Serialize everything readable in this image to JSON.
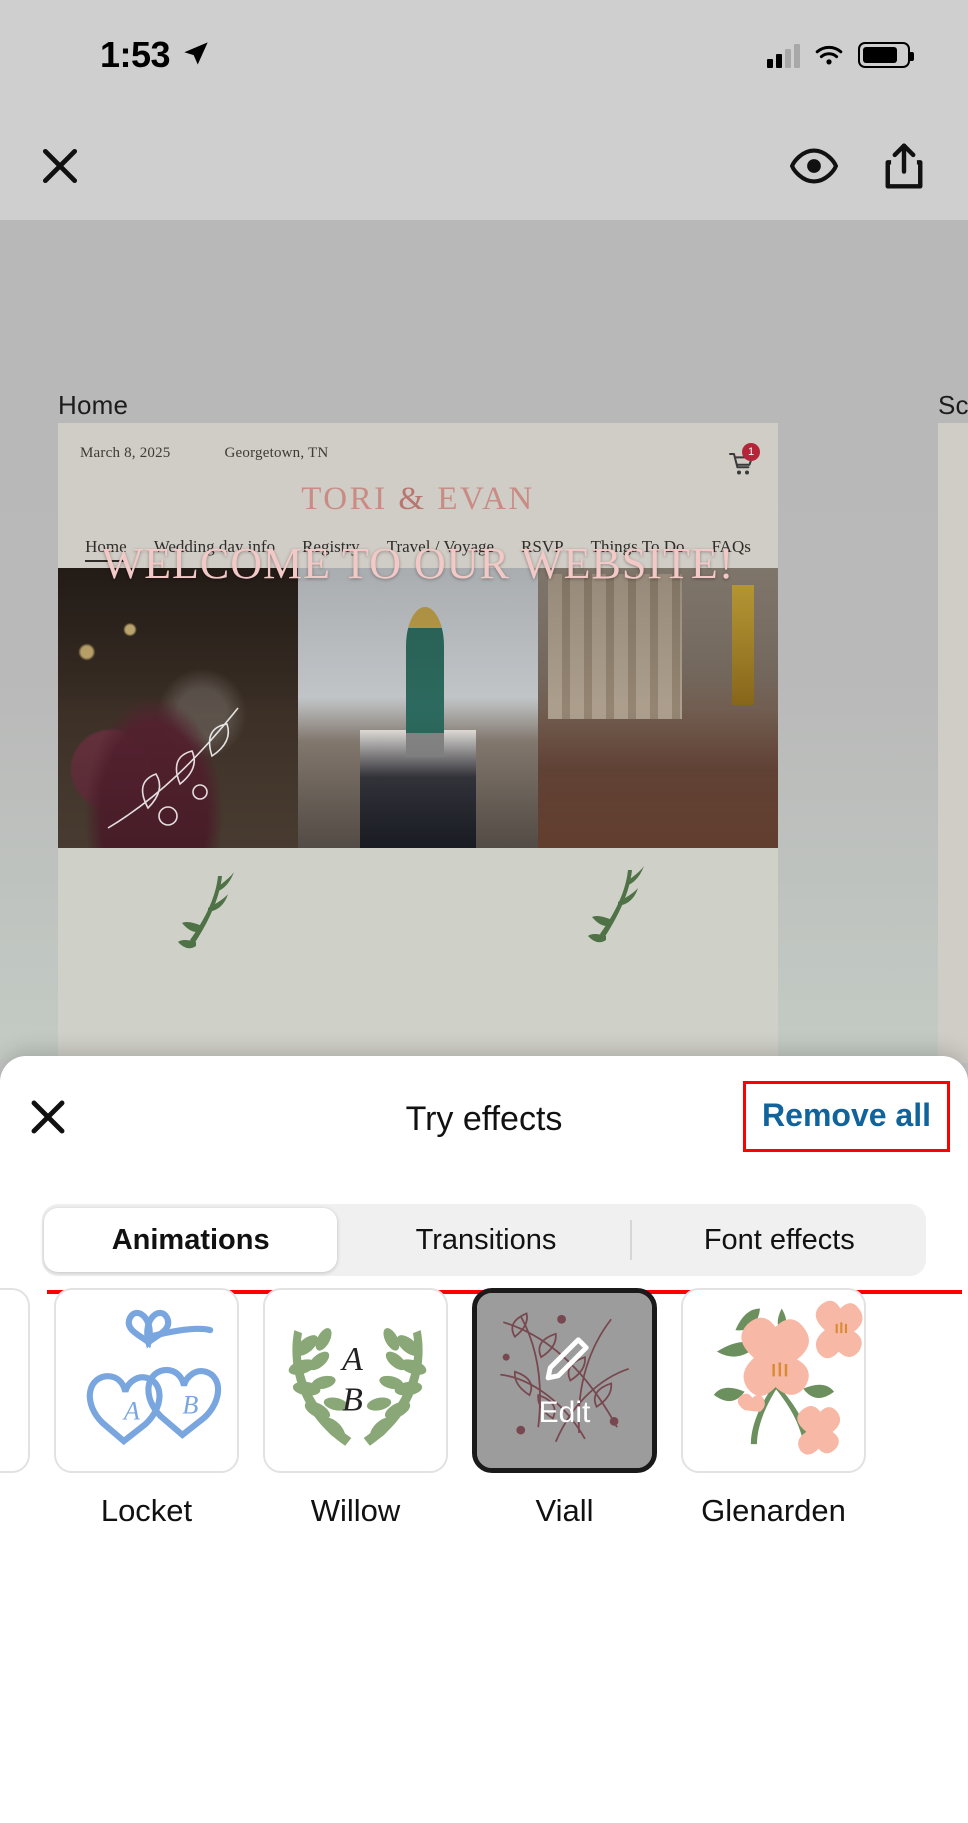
{
  "status_bar": {
    "time": "1:53",
    "location_icon": "location-arrow-icon",
    "signal_icon": "cellular-signal-icon",
    "wifi_icon": "wifi-icon",
    "battery_icon": "battery-icon"
  },
  "toolbar": {
    "close_icon": "close-x-icon",
    "preview_icon": "eye-icon",
    "share_icon": "share-icon"
  },
  "canvas": {
    "pages": [
      {
        "label": "Home"
      },
      {
        "label": "Sch"
      }
    ],
    "site": {
      "date": "March 8, 2025",
      "location": "Georgetown, TN",
      "couple_first": "TORI",
      "couple_amp": "&",
      "couple_second": "EVAN",
      "cart_icon": "shopping-cart-icon",
      "cart_badge": "1",
      "nav": [
        {
          "label": "Home",
          "active": true
        },
        {
          "label": "Wedding day info",
          "active": false
        },
        {
          "label": "Registry",
          "active": false
        },
        {
          "label": "Travel / Voyage",
          "active": false
        },
        {
          "label": "RSVP",
          "active": false
        },
        {
          "label": "Things To Do",
          "active": false
        },
        {
          "label": "FAQs",
          "active": false
        }
      ],
      "hero_text": "WELCOME TO OUR WEBSITE!"
    }
  },
  "sheet": {
    "close_icon": "close-x-icon",
    "title": "Try effects",
    "remove_all_label": "Remove all",
    "remove_all_color": "#11639c",
    "highlight_color": "#ff0000",
    "tabs": [
      {
        "label": "Animations",
        "active": true
      },
      {
        "label": "Transitions",
        "active": false
      },
      {
        "label": "Font effects",
        "active": false
      }
    ],
    "effects": [
      {
        "label": "",
        "icon": "effect-thumbnail-partial",
        "selected": false,
        "partial": true
      },
      {
        "label": "Locket",
        "icon": "locket-hearts-icon",
        "selected": false
      },
      {
        "label": "Willow",
        "icon": "willow-wreath-icon",
        "selected": false
      },
      {
        "label": "Viall",
        "icon": "viall-botanical-icon",
        "selected": true,
        "overlay_label": "Edit",
        "overlay_icon": "pencil-edit-icon"
      },
      {
        "label": "Glenarden",
        "icon": "glenarden-floral-icon",
        "selected": false
      }
    ]
  }
}
